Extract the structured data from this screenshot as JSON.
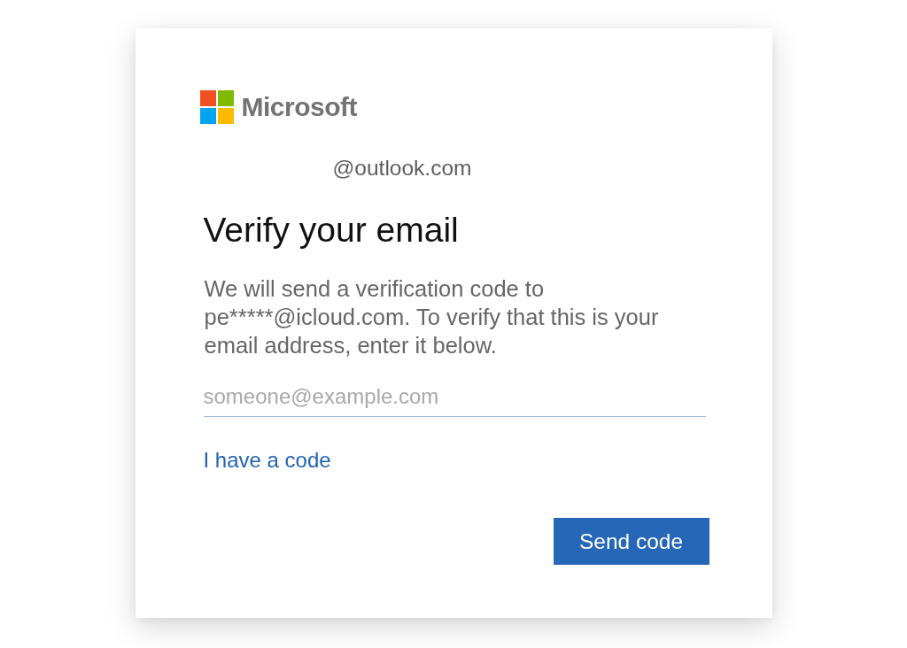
{
  "brand": {
    "name": "Microsoft"
  },
  "account": {
    "identity": "@outlook.com"
  },
  "title": "Verify your email",
  "description": "We will send a verification code to pe*****@icloud.com. To verify that this is your email address, enter it below.",
  "email_field": {
    "placeholder": "someone@example.com"
  },
  "link": {
    "label": "I have a code"
  },
  "buttons": [
    {
      "label": "Send code",
      "kind": "primary"
    }
  ]
}
